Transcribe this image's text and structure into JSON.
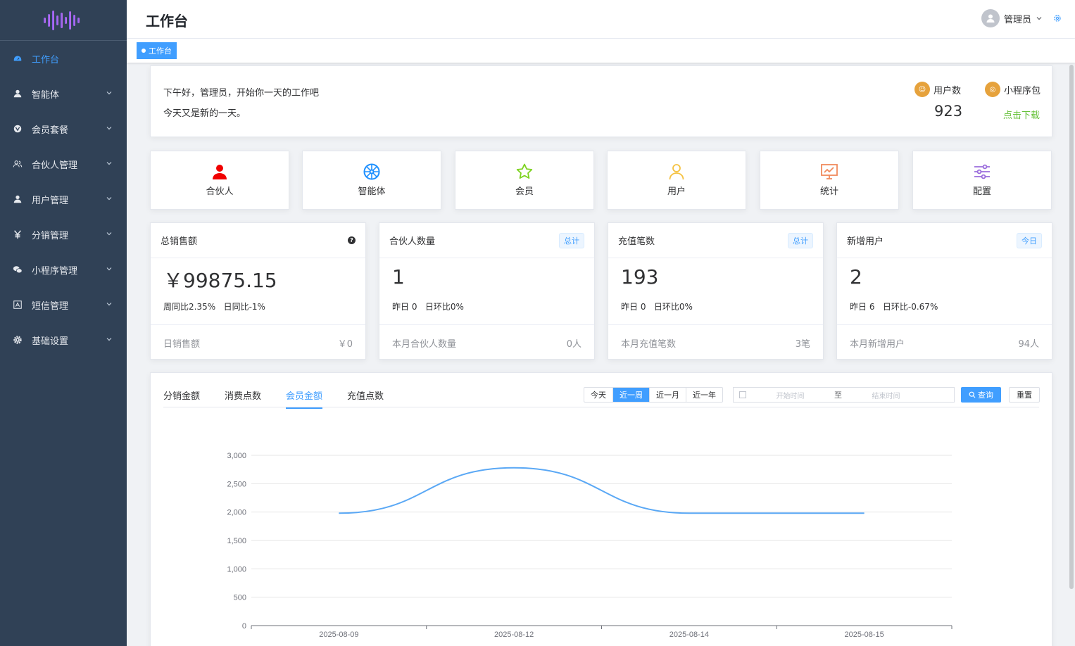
{
  "header": {
    "title": "工作台",
    "user_name": "管理员"
  },
  "tags": [
    {
      "label": "工作台"
    }
  ],
  "sidebar": {
    "items": [
      {
        "label": "工作台",
        "icon": "dashboard-icon",
        "active": true
      },
      {
        "label": "智能体",
        "icon": "user-icon"
      },
      {
        "label": "会员套餐",
        "icon": "vip-icon"
      },
      {
        "label": "合伙人管理",
        "icon": "partner-icon"
      },
      {
        "label": "用户管理",
        "icon": "user-icon"
      },
      {
        "label": "分销管理",
        "icon": "yen-icon"
      },
      {
        "label": "小程序管理",
        "icon": "wechat-icon"
      },
      {
        "label": "短信管理",
        "icon": "message-icon"
      },
      {
        "label": "基础设置",
        "icon": "gear-icon"
      }
    ]
  },
  "welcome": {
    "greeting": "下午好，管理员，开始你一天的工作吧",
    "subtitle": "今天又是新的一天。",
    "user_count_label": "用户数",
    "user_count": "923",
    "miniapp_label": "小程序包",
    "download_label": "点击下载"
  },
  "quick_nav": [
    {
      "label": "合伙人",
      "icon": "partner-icon",
      "color": "#f00000"
    },
    {
      "label": "智能体",
      "icon": "wheel-icon",
      "color": "#1e90ff"
    },
    {
      "label": "会员",
      "icon": "star-icon",
      "color": "#7ed321"
    },
    {
      "label": "用户",
      "icon": "user-outline-icon",
      "color": "#f5c242"
    },
    {
      "label": "统计",
      "icon": "chart-board-icon",
      "color": "#f08a5d"
    },
    {
      "label": "配置",
      "icon": "sliders-icon",
      "color": "#9b6ddc"
    }
  ],
  "stats": [
    {
      "title": "总销售额",
      "badge": "",
      "value": "￥99875.15",
      "sub": "周同比2.35%   日同比-1%",
      "foot_label": "日销售额",
      "foot_value": "￥0"
    },
    {
      "title": "合伙人数量",
      "badge": "总计",
      "value": "1",
      "sub": "昨日 0   日环比0%",
      "foot_label": "本月合伙人数量",
      "foot_value": "0人"
    },
    {
      "title": "充值笔数",
      "badge": "总计",
      "value": "193",
      "sub": "昨日 0   日环比0%",
      "foot_label": "本月充值笔数",
      "foot_value": "3笔"
    },
    {
      "title": "新增用户",
      "badge": "今日",
      "value": "2",
      "sub": "昨日 6   日环比-0.67%",
      "foot_label": "本月新增用户",
      "foot_value": "94人"
    }
  ],
  "chart_panel": {
    "tabs": [
      "分销金额",
      "消费点数",
      "会员金额",
      "充值点数"
    ],
    "active_tab": 2,
    "ranges": [
      "今天",
      "近一周",
      "近一月",
      "近一年"
    ],
    "active_range": 1,
    "start_placeholder": "开始时间",
    "end_placeholder": "结束时间",
    "range_sep": "至",
    "query_label": "查询",
    "reset_label": "重置"
  },
  "chart_data": {
    "type": "line",
    "x": [
      "2025-08-09",
      "2025-08-12",
      "2025-08-14",
      "2025-08-15"
    ],
    "values": [
      1980,
      2780,
      1980,
      1980
    ],
    "ylim": [
      0,
      3000
    ],
    "yticks": [
      "0",
      "500",
      "1,000",
      "1,500",
      "2,000",
      "2,500",
      "3,000"
    ],
    "color": "#5aa8f5",
    "grid": true,
    "smooth": true
  }
}
